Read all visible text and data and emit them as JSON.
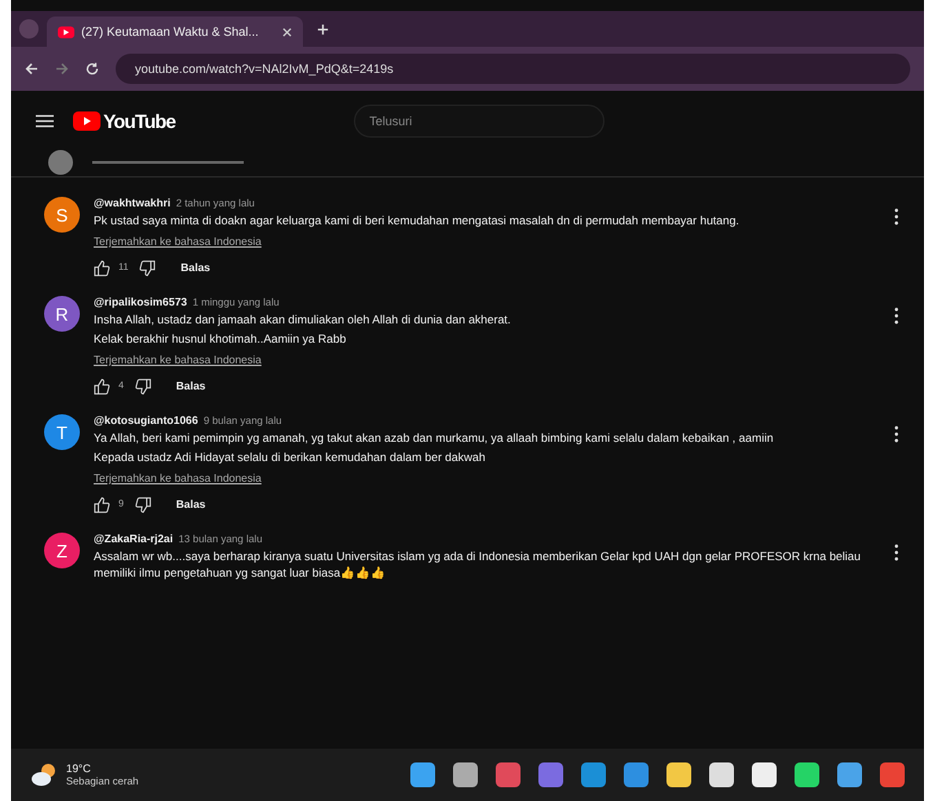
{
  "browser": {
    "tab_title": "(27) Keutamaan Waktu & Shal...",
    "url": "youtube.com/watch?v=NAl2IvM_PdQ&t=2419s"
  },
  "youtube": {
    "logo": "YouTube",
    "search": {
      "placeholder": "Telusuri"
    }
  },
  "comments": [
    {
      "initial": "S",
      "color": "#e8710a",
      "author": "@wakhtwakhri",
      "time": "2 tahun yang lalu",
      "lines": [
        "Pk ustad saya minta di doakn agar keluarga kami di beri kemudahan mengatasi masalah dn di permudah membayar hutang."
      ],
      "translate": "Terjemahkan ke bahasa Indonesia",
      "likes": "11",
      "reply": "Balas"
    },
    {
      "initial": "R",
      "color": "#7e57c2",
      "author": "@ripalikosim6573",
      "time": "1 minggu yang lalu",
      "lines": [
        "Insha Allah, ustadz dan jamaah akan dimuliakan oleh Allah di dunia dan akherat.",
        "Kelak berakhir husnul khotimah..Aamiin ya Rabb"
      ],
      "translate": "Terjemahkan ke bahasa Indonesia",
      "likes": "4",
      "reply": "Balas"
    },
    {
      "initial": "T",
      "color": "#1e88e5",
      "author": "@kotosugianto1066",
      "time": "9 bulan yang lalu",
      "lines": [
        "Ya Allah, beri kami pemimpin yg amanah, yg takut akan azab  dan murkamu, ya allaah bimbing kami selalu dalam kebaikan , aamiin",
        "Kepada ustadz Adi Hidayat selalu di berikan kemudahan dalam ber dakwah"
      ],
      "translate": "Terjemahkan ke bahasa Indonesia",
      "likes": "9",
      "reply": "Balas"
    },
    {
      "initial": "Z",
      "color": "#e91e63",
      "author": "@ZakaRia-rj2ai",
      "time": "13 bulan yang lalu",
      "lines": [
        "Assalam  wr wb....saya berharap kiranya suatu Universitas islam yg ada di Indonesia memberikan Gelar kpd UAH dgn gelar PROFESOR krna beliau memiliki ilmu pengetahuan yg sangat luar biasa👍👍👍"
      ]
    }
  ],
  "taskbar": {
    "temperature": "19°C",
    "weather": "Sebagian cerah"
  }
}
